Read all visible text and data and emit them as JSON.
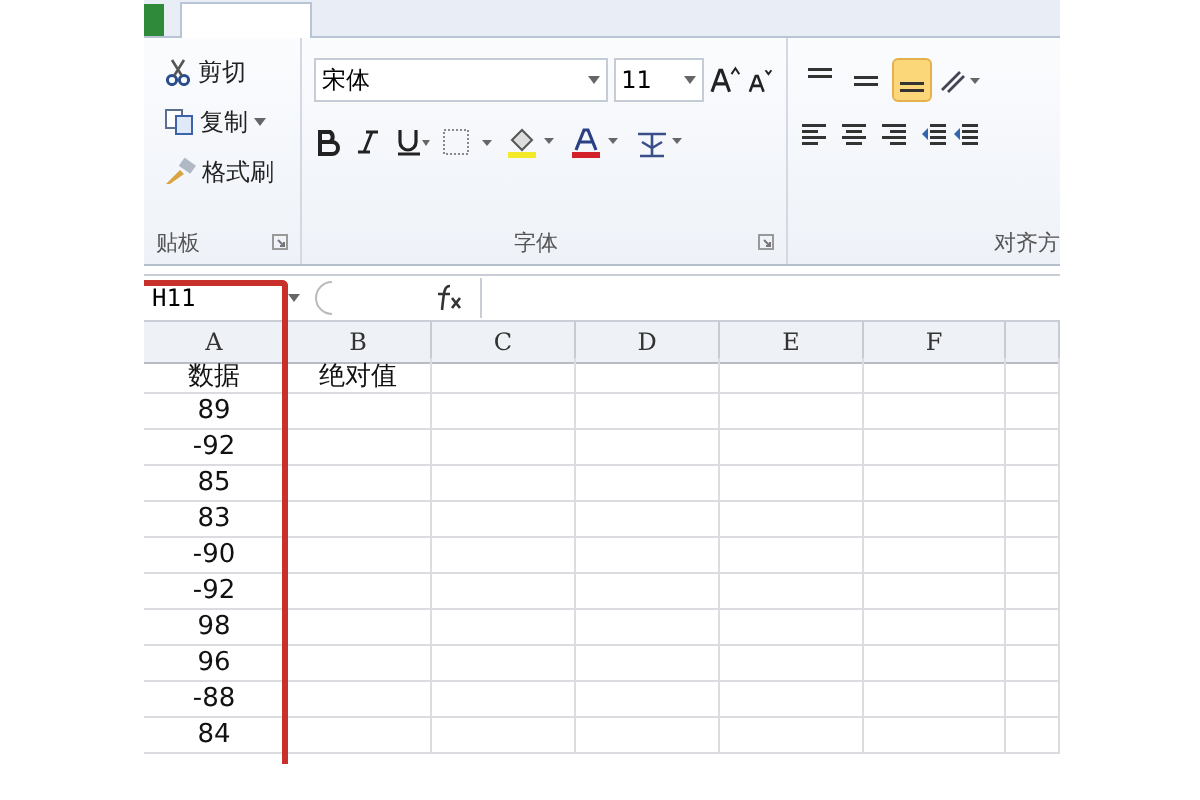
{
  "ribbon": {
    "clipboard": {
      "buttons": [
        {
          "kind": "cut",
          "label": "剪切",
          "dropdown": false
        },
        {
          "kind": "copy",
          "label": "复制",
          "dropdown": true
        },
        {
          "kind": "painter",
          "label": "格式刷",
          "dropdown": false
        }
      ],
      "label": "贴板"
    },
    "font": {
      "name": "宋体",
      "size": "11",
      "label": "字体"
    },
    "alignment": {
      "vertical": [
        {
          "selected": false
        },
        {
          "selected": false
        },
        {
          "selected": true
        }
      ],
      "label": "对齐方"
    }
  },
  "formula_bar": {
    "name_box": "H11"
  },
  "sheet": {
    "columns": [
      {
        "label": "A",
        "highlighted": true
      },
      {
        "label": "B",
        "highlighted": false
      },
      {
        "label": "C",
        "highlighted": false
      },
      {
        "label": "D",
        "highlighted": false
      },
      {
        "label": "E",
        "highlighted": false
      },
      {
        "label": "F",
        "highlighted": false
      }
    ],
    "rows": [
      [
        "数据",
        "绝对值"
      ],
      [
        "89"
      ],
      [
        "-92"
      ],
      [
        "85"
      ],
      [
        "83"
      ],
      [
        "-90"
      ],
      [
        "-92"
      ],
      [
        "98"
      ],
      [
        "96"
      ],
      [
        "-88"
      ],
      [
        "84"
      ]
    ]
  }
}
